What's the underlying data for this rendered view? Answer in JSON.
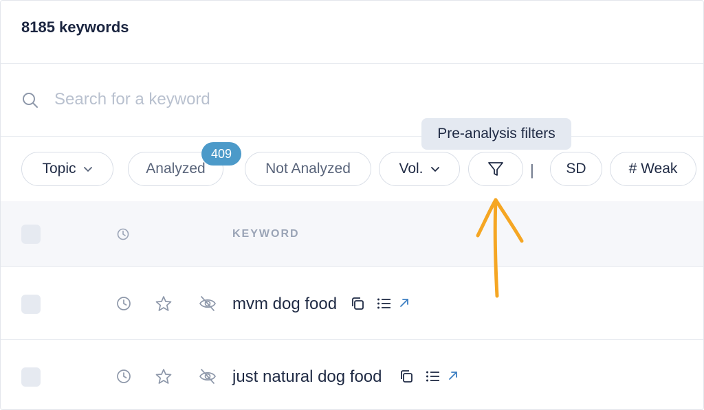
{
  "header": {
    "title": "8185 keywords"
  },
  "search": {
    "placeholder": "Search for a keyword",
    "value": ""
  },
  "filters": {
    "topic": "Topic",
    "analyzed": "Analyzed",
    "analyzed_count": "409",
    "not_analyzed": "Not Analyzed",
    "volume": "Vol.",
    "separator": "|",
    "sd": "SD",
    "weak": "# Weak"
  },
  "tooltip": {
    "text": "Pre-analysis filters"
  },
  "table": {
    "columns": {
      "keyword": "KEYWORD"
    },
    "rows": [
      {
        "keyword": "mvm dog food"
      },
      {
        "keyword": "just natural dog food"
      }
    ]
  },
  "icons": {
    "search": "search-icon",
    "filter": "funnel-icon",
    "history": "clock-icon",
    "favorite": "star-icon",
    "hide": "eye-off-icon",
    "copy": "copy-icon",
    "list": "list-icon",
    "open": "external-link-icon"
  },
  "colors": {
    "badge": "#4c9ac9",
    "annotation": "#f5a623",
    "tooltip_bg": "#e4e9f1",
    "accent_link": "#3b7ec2"
  }
}
